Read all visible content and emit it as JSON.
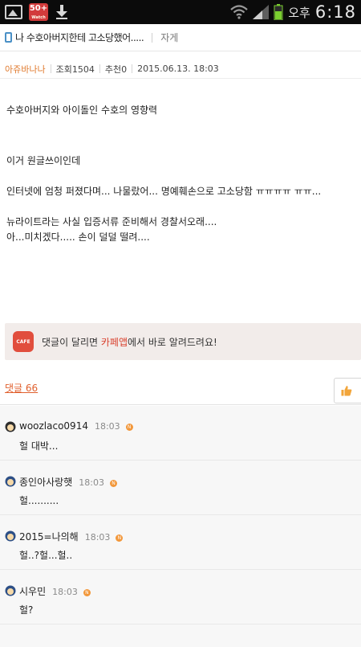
{
  "status_bar": {
    "badge_number": "50+",
    "badge_caption": "Watch",
    "time_prefix": "오후",
    "time": "6:18"
  },
  "title_bar": {
    "post_title": "나 수호아버지한테 고소당했어.....",
    "board": "자게"
  },
  "meta": {
    "author": "아쥬바나나",
    "views": "조회1504",
    "recommend": "추천0",
    "datetime": "2015.06.13. 18:03"
  },
  "body": {
    "paragraphs": [
      "수호아버지와 아이돌인 수호의 영향력",
      "이거 원글쓰이인데",
      "인터넷에 엄청 퍼졌다며... 나물랐어... 명예훼손으로 고소당함 ㅠㅠㅠㅠ ㅠㅠ...",
      "뉴라이트라는 사실 입증서류 준비해서 경찰서오래....",
      "아...미치겠다..... 손이 덜덜 떨려...."
    ]
  },
  "cafe_notice": {
    "icon_label": "CAFE",
    "text_before": "댓글이 달리면 ",
    "text_highlight": "카페앱",
    "text_after": "에서 바로 알려드려요!",
    "highlight_color": "#d9422f"
  },
  "comments_header": {
    "count_label": "댓글 66"
  },
  "comments": [
    {
      "name": "woozlaco0914",
      "time": "18:03",
      "badge": "N",
      "text": "헐 대박..."
    },
    {
      "name": "종인아사랑햇",
      "time": "18:03",
      "badge": "N",
      "text": "헐.........."
    },
    {
      "name": "2015=나의해",
      "time": "18:03",
      "badge": "N",
      "text": "헐..?헐...헐.."
    },
    {
      "name": "시우민",
      "time": "18:03",
      "badge": "N",
      "text": "헐?"
    }
  ]
}
